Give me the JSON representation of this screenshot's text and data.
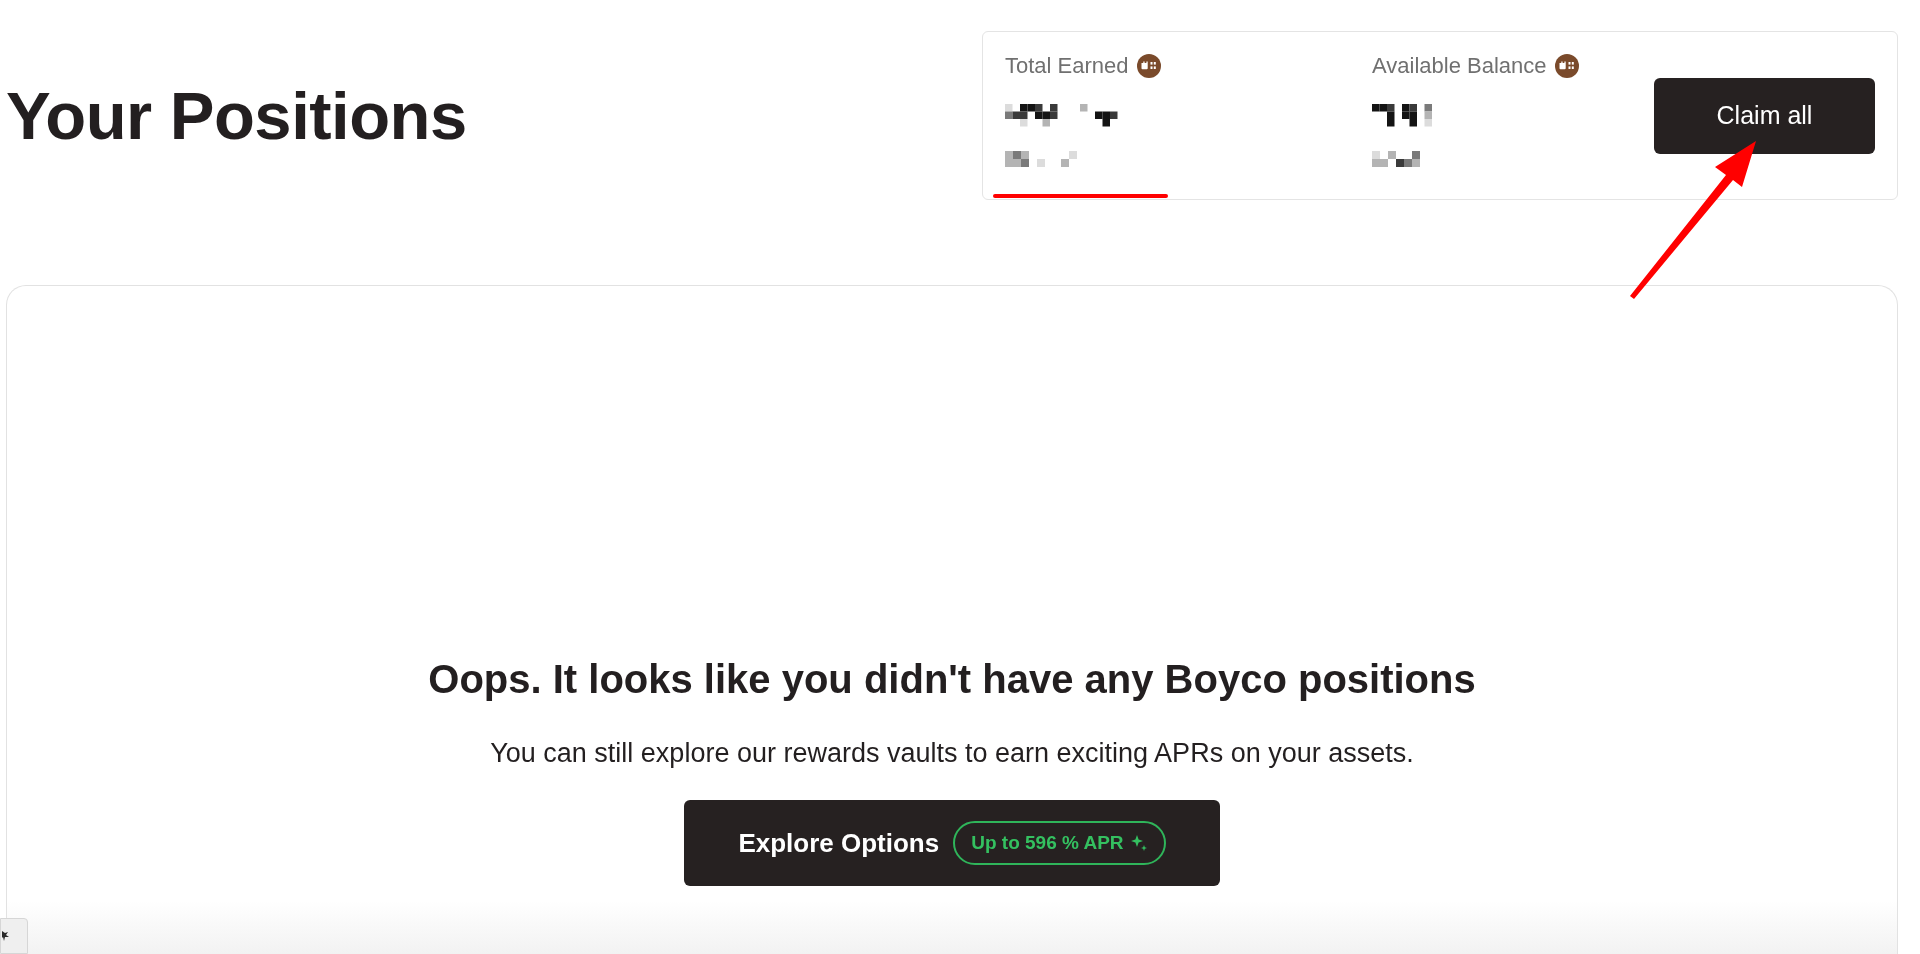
{
  "page": {
    "title": "Your Positions"
  },
  "summary": {
    "stats": [
      {
        "label": "Total Earned",
        "annotated": true
      },
      {
        "label": "Available Balance",
        "annotated": false
      }
    ],
    "claim_button": {
      "label": "Claim all",
      "annotated": true
    }
  },
  "empty_state": {
    "heading": "Oops. It looks like you didn't have any Boyco positions",
    "message": "You can still explore our rewards vaults to earn exciting APRs on your assets.",
    "button": {
      "label": "Explore Options",
      "badge": "Up to 596 % APR"
    }
  }
}
